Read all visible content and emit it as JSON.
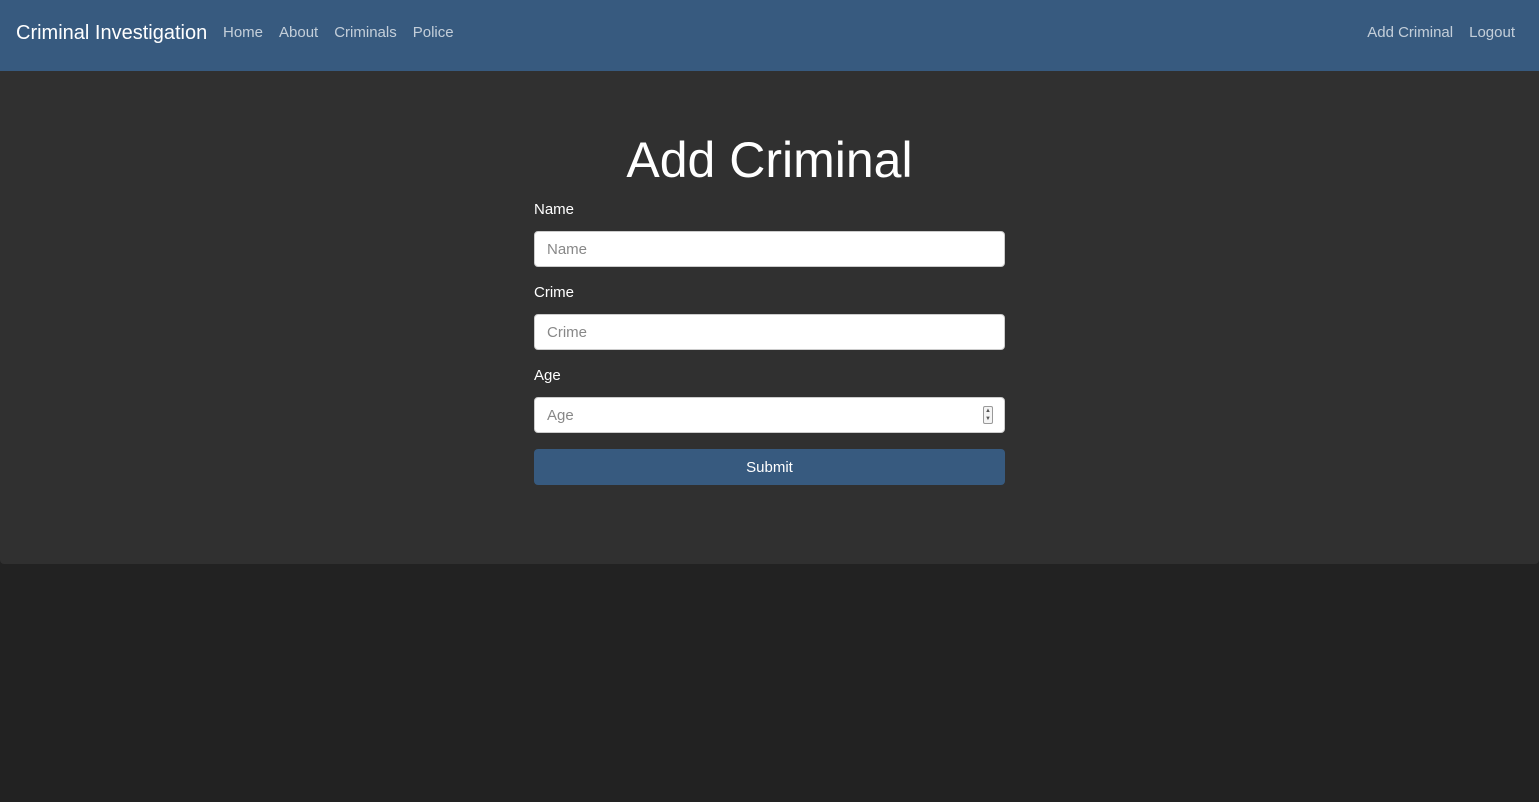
{
  "navbar": {
    "brand": "Criminal Investigation",
    "left_links": [
      "Home",
      "About",
      "Criminals",
      "Police"
    ],
    "right_links": [
      "Add Criminal",
      "Logout"
    ]
  },
  "page": {
    "title": "Add Criminal"
  },
  "form": {
    "name_label": "Name",
    "name_placeholder": "Name",
    "name_value": "",
    "crime_label": "Crime",
    "crime_placeholder": "Crime",
    "crime_value": "",
    "age_label": "Age",
    "age_placeholder": "Age",
    "age_value": "",
    "submit_label": "Submit"
  },
  "colors": {
    "navbar": "#375a7f",
    "panel": "#303030",
    "background": "#222222",
    "accent": "#375a7f"
  }
}
